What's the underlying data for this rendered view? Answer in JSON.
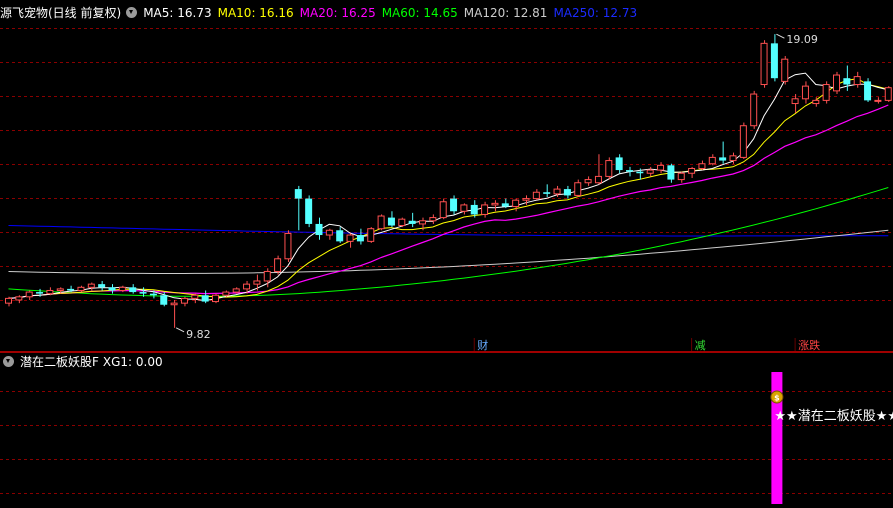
{
  "main_header": {
    "title": "源飞宠物(日线 前复权)",
    "ma": [
      {
        "label": "MA5: 16.73",
        "color": "#ffffff"
      },
      {
        "label": "MA10: 16.16",
        "color": "#ffff00"
      },
      {
        "label": "MA20: 16.25",
        "color": "#ff00ff"
      },
      {
        "label": "MA60: 14.65",
        "color": "#00ff00"
      },
      {
        "label": "MA120: 12.81",
        "color": "#cccccc"
      },
      {
        "label": "MA250: 12.73",
        "color": "#0000ff"
      }
    ]
  },
  "sub_header": {
    "title": "潜在二板妖股F",
    "xg": "XG1: 0.00"
  },
  "annotations": {
    "high": "19.09",
    "low": "9.82",
    "signal": "★★潜在二板妖股★★",
    "money_icon": "money-bag-icon"
  },
  "event_markers": [
    {
      "label": "财",
      "color": "#66aaff",
      "bar": 45
    },
    {
      "label": "减",
      "color": "#33dd33",
      "bar": 66
    },
    {
      "label": "涨跌",
      "color": "#ff4444",
      "bar": 76
    }
  ],
  "chart_data": {
    "type": "candlestick",
    "ohlc": [
      [
        10.6,
        10.8,
        10.5,
        10.75
      ],
      [
        10.7,
        10.85,
        10.6,
        10.8
      ],
      [
        10.8,
        11.0,
        10.7,
        10.95
      ],
      [
        10.95,
        11.05,
        10.8,
        10.9
      ],
      [
        10.9,
        11.1,
        10.85,
        11.0
      ],
      [
        11.0,
        11.1,
        10.9,
        11.05
      ],
      [
        11.05,
        11.15,
        10.95,
        11.0
      ],
      [
        11.0,
        11.15,
        10.95,
        11.1
      ],
      [
        11.1,
        11.25,
        11.0,
        11.2
      ],
      [
        11.2,
        11.3,
        11.0,
        11.1
      ],
      [
        11.1,
        11.2,
        10.9,
        11.0
      ],
      [
        11.0,
        11.15,
        10.95,
        11.1
      ],
      [
        11.1,
        11.2,
        10.9,
        10.95
      ],
      [
        10.95,
        11.1,
        10.8,
        10.9
      ],
      [
        10.9,
        11.0,
        10.75,
        10.85
      ],
      [
        10.85,
        10.95,
        10.5,
        10.55
      ],
      [
        10.55,
        10.7,
        9.82,
        10.6
      ],
      [
        10.6,
        10.8,
        10.5,
        10.75
      ],
      [
        10.75,
        10.9,
        10.6,
        10.85
      ],
      [
        10.85,
        11.0,
        10.6,
        10.65
      ],
      [
        10.65,
        10.9,
        10.6,
        10.85
      ],
      [
        10.85,
        11.0,
        10.8,
        10.95
      ],
      [
        10.95,
        11.1,
        10.9,
        11.05
      ],
      [
        11.05,
        11.3,
        10.9,
        11.2
      ],
      [
        11.2,
        11.5,
        11.0,
        11.3
      ],
      [
        11.3,
        11.7,
        11.1,
        11.6
      ],
      [
        11.6,
        12.1,
        11.5,
        12.0
      ],
      [
        12.0,
        12.9,
        11.9,
        12.8
      ],
      [
        14.2,
        14.3,
        12.9,
        13.9
      ],
      [
        13.9,
        14.0,
        13.0,
        13.1
      ],
      [
        13.1,
        13.3,
        12.6,
        12.75
      ],
      [
        12.75,
        12.95,
        12.6,
        12.9
      ],
      [
        12.9,
        13.0,
        12.5,
        12.55
      ],
      [
        12.55,
        12.8,
        12.35,
        12.75
      ],
      [
        12.75,
        12.95,
        12.45,
        12.55
      ],
      [
        12.55,
        13.0,
        12.5,
        12.95
      ],
      [
        12.95,
        13.4,
        12.9,
        13.35
      ],
      [
        13.3,
        13.5,
        13.0,
        13.05
      ],
      [
        13.05,
        13.3,
        13.0,
        13.25
      ],
      [
        13.2,
        13.45,
        13.0,
        13.1
      ],
      [
        13.1,
        13.3,
        12.9,
        13.2
      ],
      [
        13.2,
        13.4,
        13.1,
        13.3
      ],
      [
        13.3,
        13.9,
        13.25,
        13.8
      ],
      [
        13.9,
        14.0,
        13.4,
        13.5
      ],
      [
        13.5,
        13.75,
        13.4,
        13.7
      ],
      [
        13.7,
        13.85,
        13.3,
        13.4
      ],
      [
        13.4,
        13.8,
        13.3,
        13.7
      ],
      [
        13.7,
        13.85,
        13.5,
        13.75
      ],
      [
        13.75,
        13.9,
        13.6,
        13.65
      ],
      [
        13.65,
        13.9,
        13.5,
        13.85
      ],
      [
        13.85,
        14.0,
        13.7,
        13.9
      ],
      [
        13.9,
        14.2,
        13.85,
        14.1
      ],
      [
        14.1,
        14.35,
        13.95,
        14.05
      ],
      [
        14.05,
        14.3,
        13.95,
        14.2
      ],
      [
        14.2,
        14.3,
        13.9,
        14.0
      ],
      [
        14.0,
        14.5,
        13.95,
        14.4
      ],
      [
        14.4,
        14.6,
        14.3,
        14.5
      ],
      [
        14.4,
        15.3,
        14.35,
        14.6
      ],
      [
        14.6,
        15.2,
        14.5,
        15.1
      ],
      [
        15.2,
        15.3,
        14.7,
        14.8
      ],
      [
        14.8,
        14.9,
        14.6,
        14.75
      ],
      [
        14.75,
        14.85,
        14.5,
        14.7
      ],
      [
        14.7,
        14.9,
        14.6,
        14.8
      ],
      [
        14.8,
        15.05,
        14.7,
        14.95
      ],
      [
        14.95,
        15.0,
        14.4,
        14.5
      ],
      [
        14.5,
        14.75,
        14.4,
        14.7
      ],
      [
        14.7,
        14.9,
        14.55,
        14.85
      ],
      [
        14.85,
        15.1,
        14.8,
        15.0
      ],
      [
        15.0,
        15.3,
        14.95,
        15.2
      ],
      [
        15.2,
        15.7,
        15.0,
        15.1
      ],
      [
        15.1,
        15.35,
        15.0,
        15.25
      ],
      [
        15.2,
        16.3,
        15.15,
        16.2
      ],
      [
        16.2,
        17.3,
        16.1,
        17.2
      ],
      [
        17.5,
        18.9,
        17.4,
        18.8
      ],
      [
        18.8,
        19.09,
        17.6,
        17.7
      ],
      [
        17.6,
        18.4,
        17.5,
        18.3
      ],
      [
        16.9,
        17.2,
        16.6,
        17.05
      ],
      [
        17.05,
        17.6,
        16.9,
        17.45
      ],
      [
        16.9,
        17.1,
        16.8,
        17.0
      ],
      [
        17.0,
        17.6,
        16.9,
        17.5
      ],
      [
        17.3,
        17.9,
        17.2,
        17.8
      ],
      [
        17.7,
        18.1,
        17.3,
        17.5
      ],
      [
        17.5,
        17.9,
        17.4,
        17.75
      ],
      [
        17.6,
        17.7,
        16.95,
        17.0
      ],
      [
        17.0,
        17.1,
        16.9,
        17.0
      ],
      [
        17.0,
        17.45,
        16.95,
        17.4
      ]
    ],
    "y_range": [
      9.5,
      19.6
    ],
    "ma_latest": {
      "MA5": 16.73,
      "MA10": 16.16,
      "MA20": 16.25,
      "MA60": 14.65,
      "MA120": 12.81,
      "MA250": 12.73
    },
    "indicator": {
      "name": "潜在二板妖股F",
      "XG1": 0.0,
      "signal_bar": 74
    }
  },
  "colors": {
    "up": "#ff5050",
    "down": "#54ffff",
    "grid": "#8a0000",
    "divider": "#a00000",
    "ma5": "#ffffff",
    "ma10": "#ffff00",
    "ma20": "#ff00ff",
    "ma60": "#00ff00",
    "ma120": "#cccccc",
    "ma250": "#0000ff",
    "signal_bar": "#ff00ff"
  }
}
